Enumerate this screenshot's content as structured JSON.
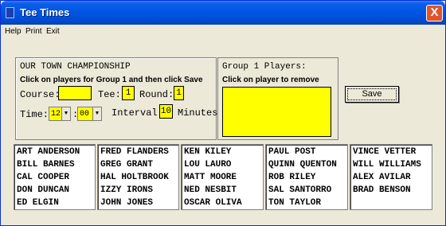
{
  "window": {
    "title": "Tee Times",
    "close_label": "X"
  },
  "menu": {
    "items": [
      "Help",
      "Print",
      "Exit"
    ]
  },
  "setup": {
    "title": "OUR TOWN CHAMPIONSHIP",
    "instructions": "Click on players for Group 1 and then click Save",
    "course_label": "Course:",
    "course_value": "",
    "tee_label": "Tee:",
    "tee_value": "1",
    "round_label": "Round:",
    "round_value": "1",
    "time_label": "Time:",
    "hour_value": "12",
    "minute_value": "00",
    "time_separator": ":",
    "interval_label": "Interval:",
    "interval_value": "10",
    "interval_unit": "Minutes"
  },
  "group": {
    "title": "Group 1 Players:",
    "instructions": "Click on player to remove"
  },
  "save_label": "Save",
  "player_lists": [
    [
      "ART ANDERSON",
      "BILL BARNES",
      "CAL COOPER",
      "DON DUNCAN",
      "ED ELGIN"
    ],
    [
      "FRED FLANDERS",
      "GREG GRANT",
      "HAL HOLTBROOK",
      "IZZY IRONS",
      "JOHN JONES"
    ],
    [
      "KEN KILEY",
      "LOU LAURO",
      "MATT MOORE",
      "NED NESBIT",
      "OSCAR OLIVA"
    ],
    [
      "PAUL POST",
      "QUINN QUENTON",
      "ROB RILEY",
      "SAL SANTORRO",
      "TON TAYLOR"
    ],
    [
      "VINCE VETTER",
      "WILL WILLIAMS",
      "ALEX AVILAR",
      "BRAD BENSON"
    ]
  ],
  "colors": {
    "field": "#ffff00",
    "titlebar": "#0054e3",
    "background": "#ece9d8"
  },
  "icons": {
    "window": "app-icon",
    "close": "close-icon",
    "dropdown": "chevron-down-icon"
  }
}
